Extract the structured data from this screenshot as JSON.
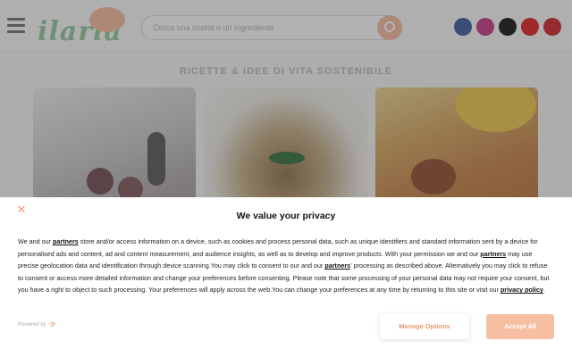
{
  "site": {
    "logo_text": "ilaria",
    "logo_badge": "",
    "search_placeholder": "Cerca una ricetta o un ingrediente",
    "section_title": "RICETTE & IDEE DI VITA SOSTENIBILE",
    "social_icons": [
      {
        "name": "facebook-icon",
        "color": "#3b5998"
      },
      {
        "name": "instagram-icon",
        "color": "#c13584"
      },
      {
        "name": "tiktok-icon",
        "color": "#111111"
      },
      {
        "name": "youtube-icon",
        "color": "#e01d1d"
      },
      {
        "name": "pinterest-icon",
        "color": "#cb2027"
      }
    ]
  },
  "consent": {
    "title": "We value your privacy",
    "close_icon": "close-icon",
    "body": [
      {
        "t": "We and our "
      },
      {
        "link": "partners"
      },
      {
        "t": " store and/or access information on a device, such as cookies and process personal data, such as unique identifiers and standard information sent by a device for personalised ads and content, ad and content measurement, and audience insights, as well as to develop and improve products. With your permission we and our "
      },
      {
        "link": "partners"
      },
      {
        "t": " may use precise geolocation data and identification through device scanning.You may click to consent to our and our "
      },
      {
        "link": "partners"
      },
      {
        "t": "’ processing as described above. Alternatively you may click to refuse to consent or access more detailed information and change your preferences before consenting. Please note that some processing of your personal data may not require your consent, but you have a right to object to such processing. Your preferences will apply across the web.You can change your preferences at any time by returning to this site or visit our "
      },
      {
        "link": "privacy policy"
      },
      {
        "t": "."
      }
    ],
    "powered_by": "Powered by",
    "manage_label": "Manage Options",
    "accept_label": "Accept All",
    "accent_color": "#ef9a6c"
  }
}
